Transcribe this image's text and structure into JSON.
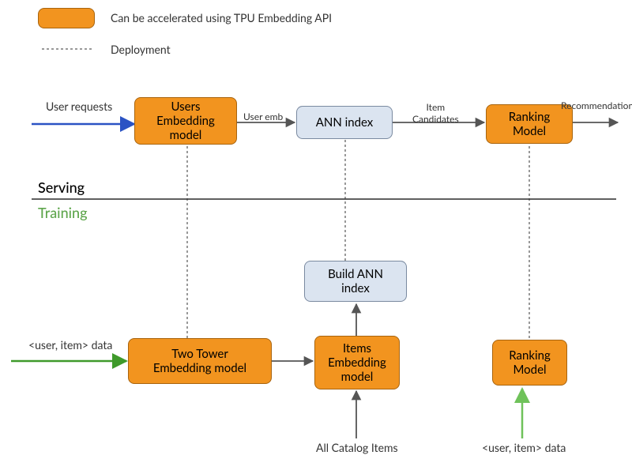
{
  "legend": {
    "swatch_label": "Can be accelerated using TPU Embedding API",
    "dashed_label": "Deployment"
  },
  "sections": {
    "serving": "Serving",
    "training": "Training"
  },
  "serving": {
    "input_label": "User requests",
    "users_box": "Users\nEmbedding\nmodel",
    "user_emb_label": "User emb",
    "ann_box": "ANN index",
    "candidates_label": "Item\nCandidates",
    "ranking_box": "Ranking\nModel",
    "output_label": "Recommendations"
  },
  "training": {
    "input_label": "<user, item> data",
    "two_tower_box": "Two Tower\nEmbedding model",
    "items_box": "Items\nEmbedding\nmodel",
    "build_ann_box": "Build ANN\nindex",
    "catalog_label": "All Catalog Items",
    "ranking_box": "Ranking\nModel",
    "ranking_input_label": "<user, item> data"
  }
}
